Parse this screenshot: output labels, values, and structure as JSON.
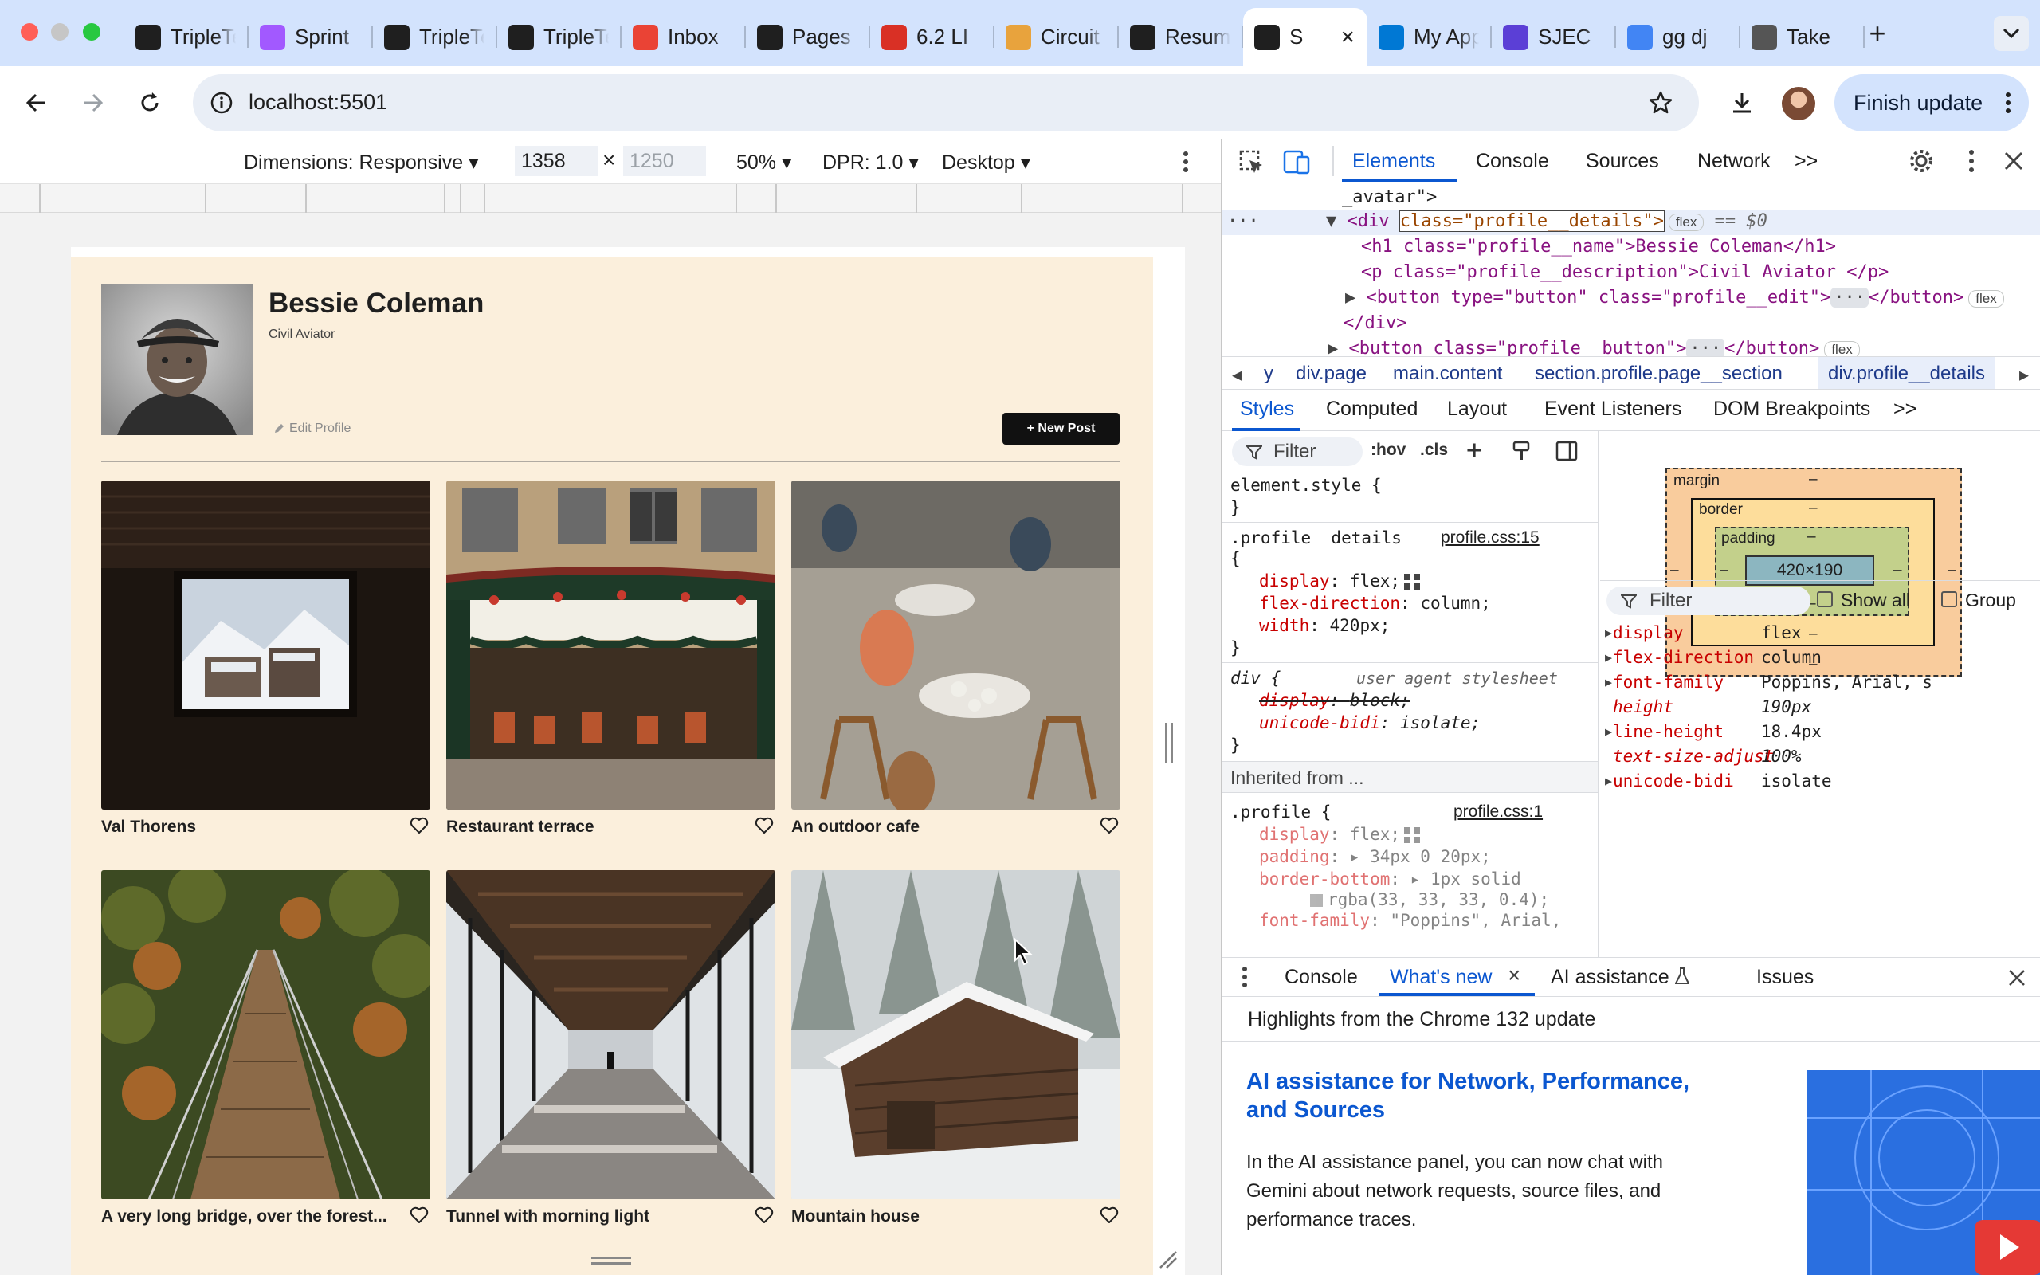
{
  "browser": {
    "tabs": [
      {
        "title": "TripleTen",
        "icon": "tripleten-icon",
        "color": "#1f1f1f"
      },
      {
        "title": "Sprint",
        "icon": "figma-icon",
        "color": "#a259ff"
      },
      {
        "title": "TripleTen",
        "icon": "tripleten-icon",
        "color": "#1f1f1f"
      },
      {
        "title": "TripleTen",
        "icon": "tripleten-icon",
        "color": "#1f1f1f"
      },
      {
        "title": "Inbox",
        "icon": "gmail-icon",
        "color": "#ea4335"
      },
      {
        "title": "Pages",
        "icon": "github-icon",
        "color": "#1f1f1f"
      },
      {
        "title": "6.2 LI",
        "icon": "badge-icon",
        "color": "#d93025"
      },
      {
        "title": "Circuit",
        "icon": "circuit-icon",
        "color": "#e8a33d"
      },
      {
        "title": "Resume",
        "icon": "openai-icon",
        "color": "#1f1f1f"
      },
      {
        "title": "S",
        "icon": "tripleten-icon",
        "color": "#1f1f1f",
        "active": true
      },
      {
        "title": "My Apps",
        "icon": "microsoft-icon",
        "color": "#0078d4"
      },
      {
        "title": "SJEC",
        "icon": "sjec-icon",
        "color": "#5b3fd6"
      },
      {
        "title": "gg dj",
        "icon": "google-icon",
        "color": "#4285f4"
      },
      {
        "title": "Take",
        "icon": "apple-icon",
        "color": "#555555"
      }
    ],
    "url": "localhost:5501",
    "finish_update": "Finish update"
  },
  "device_toolbar": {
    "dimensions": "Dimensions: Responsive",
    "width": "1358",
    "times": "×",
    "height": "1250",
    "zoom": "50%",
    "dpr": "DPR: 1.0",
    "device": "Desktop"
  },
  "profile": {
    "name": "Bessie Coleman",
    "description": "Civil Aviator",
    "edit_label": "Edit Profile",
    "new_post_label": "+ New Post"
  },
  "cards": [
    {
      "caption": "Val Thorens"
    },
    {
      "caption": "Restaurant terrace"
    },
    {
      "caption": "An outdoor cafe"
    },
    {
      "caption": "A very long bridge, over the forest..."
    },
    {
      "caption": "Tunnel with morning light"
    },
    {
      "caption": "Mountain house"
    }
  ],
  "devtools": {
    "tabs": [
      "Elements",
      "Console",
      "Sources",
      "Network",
      ">>"
    ],
    "dom": {
      "line0": "_avatar\">",
      "line1_tag": "<div ",
      "line1_attr": "class=\"profile__details\">",
      "line1_pill": "flex",
      "line1_eq": "== $0",
      "line2": "<h1 class=\"profile__name\">Bessie Coleman</h1>",
      "line3": "<p class=\"profile__description\">Civil Aviator </p>",
      "line4": "<button type=\"button\" class=\"profile__edit\">",
      "line4_end": "</button>",
      "line4_pill": "flex",
      "line5": "</div>",
      "line6": "<button class=\"profile__button\">",
      "line6_end": "</button>",
      "line6_pill": "flex"
    },
    "breadcrumbs": [
      "y",
      "div.page",
      "main.content",
      "section.profile.page__section",
      "div.profile__details"
    ],
    "subtabs": [
      "Styles",
      "Computed",
      "Layout",
      "Event Listeners",
      "DOM Breakpoints",
      ">>"
    ],
    "filter_placeholder": "Filter",
    "hov": ":hov",
    "cls": ".cls",
    "styles": {
      "element_style": "element.style {",
      "close": "}",
      "rule1_selector": ".profile__details",
      "rule1_source": "profile.css:15",
      "rule1_open": "{",
      "rule1_props": [
        {
          "name": "display",
          "value": "flex;"
        },
        {
          "name": "flex-direction",
          "value": "column;"
        },
        {
          "name": "width",
          "value": "420px;"
        }
      ],
      "rule2_selector": "div {",
      "rule2_source": "user agent stylesheet",
      "rule2_props": [
        {
          "name": "display",
          "value": "block;"
        },
        {
          "name": "unicode-bidi",
          "value": "isolate;"
        }
      ],
      "inherited": "Inherited from ...",
      "rule3_selector": ".profile {",
      "rule3_source": "profile.css:1",
      "rule3_props": [
        {
          "name": "display",
          "value": "flex;"
        },
        {
          "name": "padding",
          "value": "34px 0 20px;"
        },
        {
          "name": "border-bottom",
          "value": "1px solid"
        },
        {
          "name": "",
          "value": "rgba(33, 33, 33, 0.4);"
        },
        {
          "name": "font-family",
          "value": "\"Poppins\", Arial,"
        }
      ]
    },
    "boxmodel": {
      "margin": "margin",
      "border": "border",
      "padding": "padding",
      "content": "420×190",
      "dash": "–"
    },
    "computed": {
      "filter": "Filter",
      "show_all": "Show all",
      "group": "Group",
      "props": [
        {
          "name": "display",
          "value": "flex",
          "italic": false
        },
        {
          "name": "flex-direction",
          "value": "column",
          "italic": false
        },
        {
          "name": "font-family",
          "value": "Poppins, Arial, s",
          "italic": false
        },
        {
          "name": "height",
          "value": "190px",
          "italic": true
        },
        {
          "name": "line-height",
          "value": "18.4px",
          "italic": false
        },
        {
          "name": "text-size-adjust",
          "value": "100%",
          "italic": true
        },
        {
          "name": "unicode-bidi",
          "value": "isolate",
          "italic": false
        }
      ]
    },
    "drawer": {
      "tabs": [
        "Console",
        "What's new",
        "AI assistance",
        "Issues"
      ],
      "highlights": "Highlights from the Chrome 132 update",
      "headline": "AI assistance for Network, Performance, and Sources",
      "body": "In the AI assistance panel, you can now chat with Gemini about network requests, source files, and performance traces."
    }
  }
}
